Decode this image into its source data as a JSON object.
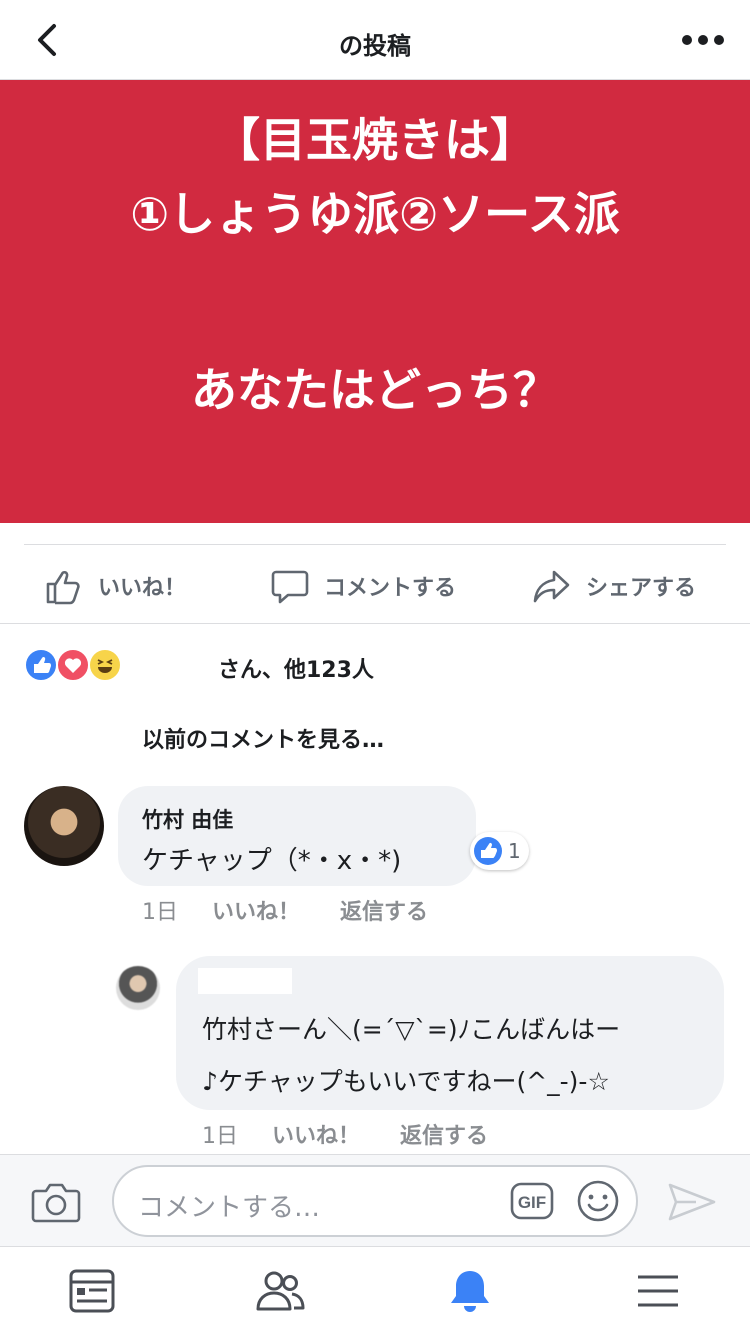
{
  "header": {
    "title": "の投稿",
    "back_icon": "chevron-left-icon",
    "more_icon": "more-horizontal-icon"
  },
  "post": {
    "background_color": "#d12a40",
    "line1": "【目玉焼きは】",
    "line2": "①しょうゆ派②ソース派",
    "line3": "あなたはどっち？"
  },
  "actions": {
    "like": "いいね！",
    "comment": "コメントする",
    "share": "シェアする"
  },
  "reactions": {
    "summary": "さん、他123人",
    "types": [
      "like",
      "love",
      "haha"
    ]
  },
  "comments_link": "以前のコメントを見る…",
  "comments": [
    {
      "author": "竹村 由佳",
      "text": "ケチャップ（*・x・*)",
      "like_count": "1",
      "time": "1日",
      "like_label": "いいね！",
      "reply_label": "返信する"
    },
    {
      "author": "",
      "line1": "竹村さーん＼(=´▽`=)ﾉこんばんはー",
      "line2": "♪ケチャップもいいですねー(^_-)-☆",
      "time": "1日",
      "like_label": "いいね！",
      "reply_label": "返信する"
    }
  ],
  "composer": {
    "placeholder": "コメントする…",
    "gif_label": "GIF"
  },
  "colors": {
    "accent": "#3b82f6",
    "love": "#f05064",
    "haha": "#f7d44a",
    "muted": "#606770"
  },
  "tabbar": [
    "news-feed-icon",
    "friends-icon",
    "notifications-icon",
    "menu-icon"
  ]
}
